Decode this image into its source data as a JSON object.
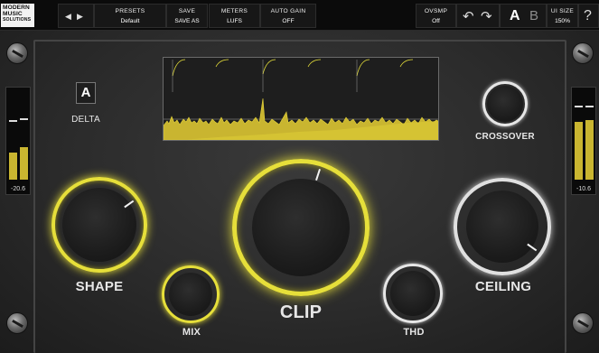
{
  "header": {
    "logo": [
      "MODERN",
      "MUSIC",
      "SOLUTIONS"
    ],
    "nav": {
      "prev_icon": "triangle-left-icon",
      "next_icon": "triangle-right-icon"
    },
    "presets": {
      "label": "PRESETS",
      "value": "Default"
    },
    "save": {
      "save_label": "SAVE",
      "save_as_label": "SAVE AS"
    },
    "meters": {
      "label": "METERS",
      "value": "LUFS"
    },
    "auto_gain": {
      "label": "AUTO GAIN",
      "value": "OFF"
    },
    "ovsmp": {
      "label": "OVSMP",
      "value": "Off"
    },
    "undo_icon": "undo-icon",
    "redo_icon": "redo-icon",
    "ab": {
      "a": "A",
      "b": "B"
    },
    "ui_size": {
      "label": "UI SIZE",
      "value": "150%"
    },
    "help": "?"
  },
  "meters": {
    "input": {
      "readout": "-20.6",
      "left_level": 0.3,
      "right_level": 0.36,
      "left_peak": 0.64,
      "right_peak": 0.66
    },
    "output": {
      "readout": "-10.6",
      "left_level": 0.64,
      "right_level": 0.66,
      "left_peak": 0.8,
      "right_peak": 0.8
    }
  },
  "controls": {
    "delta": {
      "button": "A",
      "label": "DELTA"
    },
    "crossover": {
      "label": "CROSSOVER"
    },
    "shape": {
      "label": "SHAPE"
    },
    "mix": {
      "label": "MIX"
    },
    "clip": {
      "label": "CLIP"
    },
    "thd": {
      "label": "THD"
    },
    "ceiling": {
      "label": "CEILING"
    }
  },
  "colors": {
    "accent": "#e6df3a",
    "meter": "#c9b530",
    "ring_white": "#d8d8d8"
  }
}
